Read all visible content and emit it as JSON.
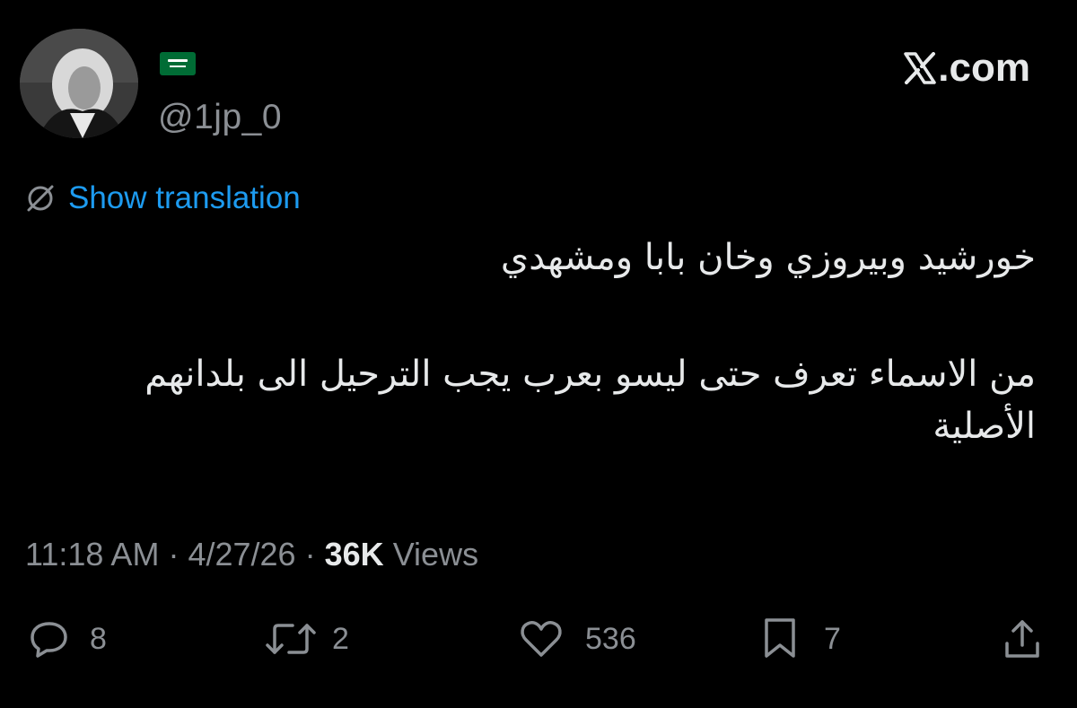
{
  "site": {
    "logo_text": ".com"
  },
  "author": {
    "handle": "@1jp_0",
    "flag_emoji_name": "saudi-arabia-flag",
    "flag_color": "#006c35"
  },
  "translate": {
    "label": "Show translation",
    "color": "#1d9bf0"
  },
  "tweet": {
    "paragraphs": [
      "خورشيد وبيروزي وخان بابا ومشهدي",
      "من الاسماء تعرف حتى ليسو بعرب يجب الترحيل الى بلدانهم الأصلية"
    ]
  },
  "meta": {
    "time": "11:18 AM",
    "separator": "·",
    "date": "4/27/26",
    "views_count": "36K",
    "views_label": "Views"
  },
  "actions": {
    "replies": "8",
    "reposts": "2",
    "likes": "536",
    "bookmarks": "7"
  },
  "colors": {
    "background": "#000000",
    "text": "#e7e9ea",
    "muted": "#8b8f94",
    "link": "#1d9bf0"
  }
}
